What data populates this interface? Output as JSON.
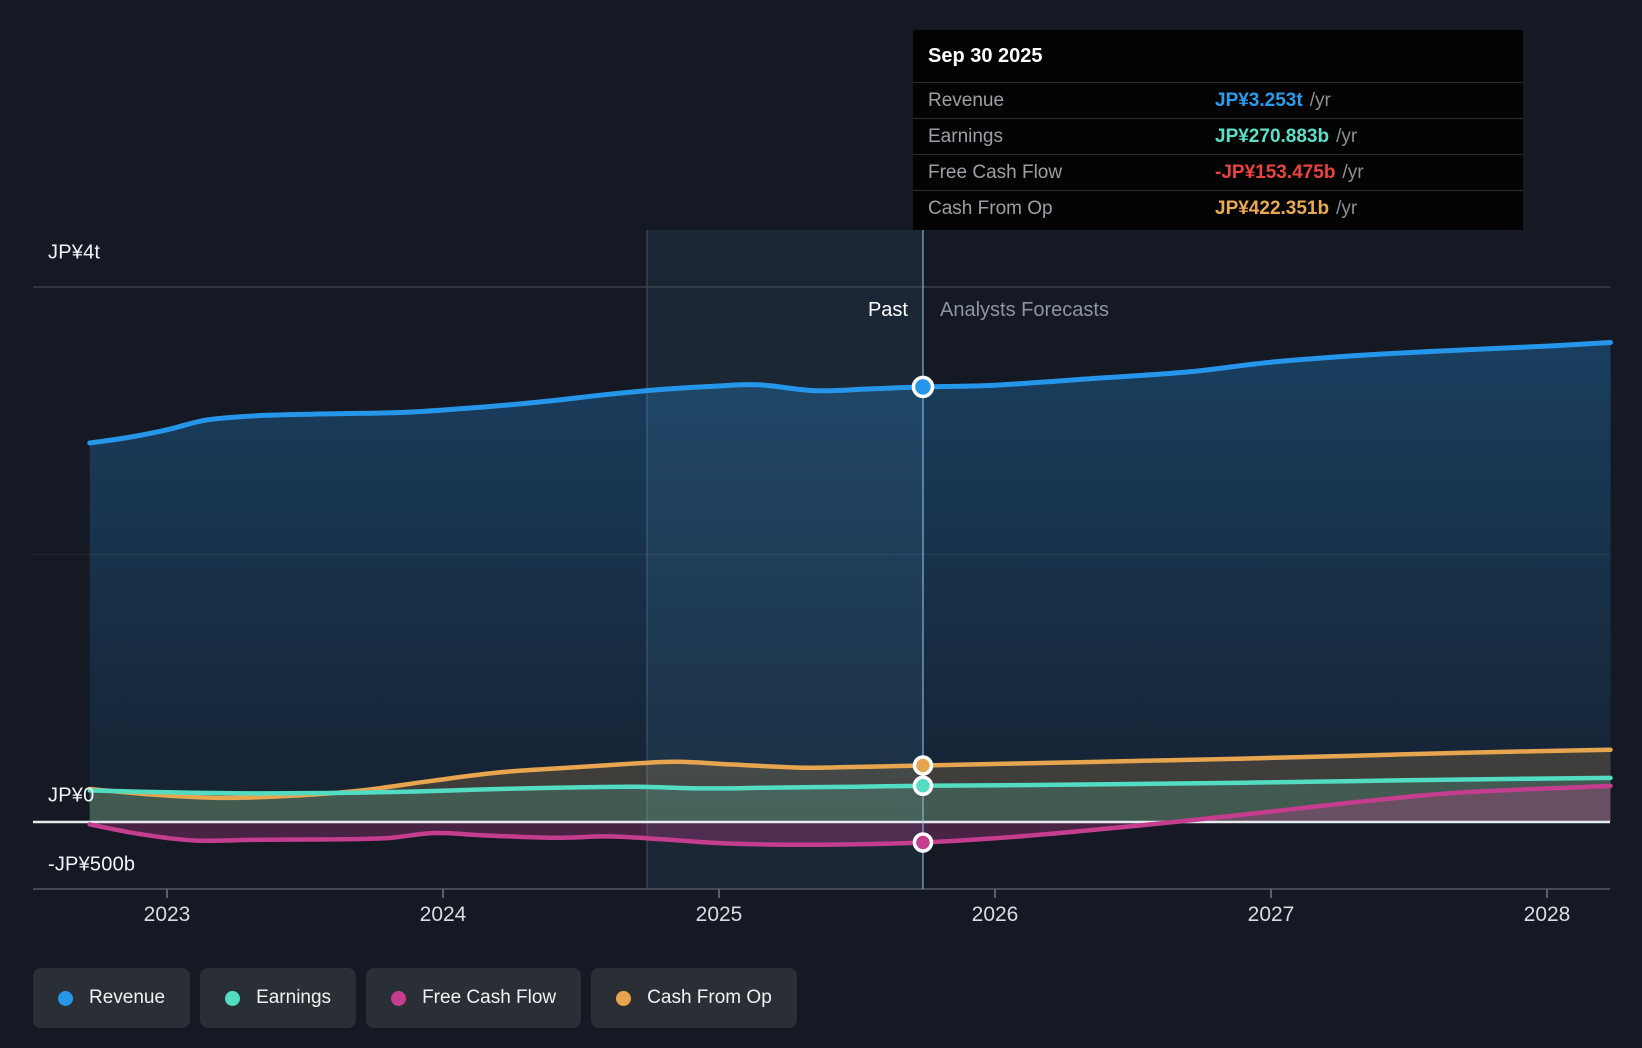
{
  "tooltip": {
    "date": "Sep 30 2025",
    "rows": [
      {
        "label": "Revenue",
        "value": "JP¥3.253t",
        "suffix": "/yr",
        "color": "#2b9df0"
      },
      {
        "label": "Earnings",
        "value": "JP¥270.883b",
        "suffix": "/yr",
        "color": "#5be0c8"
      },
      {
        "label": "Free Cash Flow",
        "value": "-JP¥153.475b",
        "suffix": "/yr",
        "color": "#ea443e"
      },
      {
        "label": "Cash From Op",
        "value": "JP¥422.351b",
        "suffix": "/yr",
        "color": "#ebaa50"
      }
    ]
  },
  "sections": {
    "past": "Past",
    "forecast": "Analysts Forecasts"
  },
  "legend": [
    {
      "label": "Revenue",
      "color": "#2696ea"
    },
    {
      "label": "Earnings",
      "color": "#52dcc2"
    },
    {
      "label": "Free Cash Flow",
      "color": "#c53d8e"
    },
    {
      "label": "Cash From Op",
      "color": "#e7a54f"
    }
  ],
  "chart_data": {
    "type": "area",
    "title": "",
    "unit": "JP¥ billions",
    "x_axis": {
      "ticks": [
        2023,
        2024,
        2025,
        2026,
        2027,
        2028
      ],
      "labels": [
        "2023",
        "2024",
        "2025",
        "2026",
        "2027",
        "2028"
      ]
    },
    "y_axis": {
      "labels": [
        {
          "text": "JP¥4t",
          "value_b": 4000
        },
        {
          "text": "JP¥0",
          "value_b": 0
        },
        {
          "text": "-JP¥500b",
          "value_b": -500
        }
      ],
      "gridlines_b": [
        4000,
        2000,
        0,
        -500
      ]
    },
    "x_domain": [
      2022.721,
      2028.228
    ],
    "divider": {
      "year": 2025.739,
      "highlight_band_years": 1
    },
    "grid": true,
    "legend_position": "bottom",
    "series": [
      {
        "name": "Revenue",
        "color": "#2696ea",
        "marker_value_b": 3253,
        "points": [
          [
            2022.72,
            2834
          ],
          [
            2022.85,
            2872
          ],
          [
            2023.0,
            2932
          ],
          [
            2023.15,
            3008
          ],
          [
            2023.35,
            3040
          ],
          [
            2023.6,
            3052
          ],
          [
            2023.85,
            3062
          ],
          [
            2024.1,
            3095
          ],
          [
            2024.35,
            3140
          ],
          [
            2024.6,
            3198
          ],
          [
            2024.8,
            3235
          ],
          [
            2025.0,
            3260
          ],
          [
            2025.15,
            3268
          ],
          [
            2025.35,
            3225
          ],
          [
            2025.55,
            3238
          ],
          [
            2025.739,
            3253
          ],
          [
            2026.0,
            3266
          ],
          [
            2026.35,
            3315
          ],
          [
            2026.7,
            3365
          ],
          [
            2027.0,
            3438
          ],
          [
            2027.35,
            3492
          ],
          [
            2027.7,
            3530
          ],
          [
            2028.0,
            3558
          ],
          [
            2028.23,
            3585
          ]
        ]
      },
      {
        "name": "Cash From Op",
        "color": "#e7a54f",
        "marker_value_b": 422.351,
        "points": [
          [
            2022.72,
            247
          ],
          [
            2022.95,
            205
          ],
          [
            2023.2,
            180
          ],
          [
            2023.45,
            196
          ],
          [
            2023.7,
            235
          ],
          [
            2023.95,
            305
          ],
          [
            2024.2,
            370
          ],
          [
            2024.45,
            405
          ],
          [
            2024.7,
            438
          ],
          [
            2024.85,
            450
          ],
          [
            2025.05,
            430
          ],
          [
            2025.3,
            406
          ],
          [
            2025.5,
            412
          ],
          [
            2025.739,
            422.351
          ],
          [
            2026.1,
            438
          ],
          [
            2026.5,
            456
          ],
          [
            2026.9,
            474
          ],
          [
            2027.3,
            495
          ],
          [
            2027.7,
            518
          ],
          [
            2028.23,
            540
          ]
        ]
      },
      {
        "name": "Earnings",
        "color": "#52dcc2",
        "marker_value_b": 270.883,
        "points": [
          [
            2022.72,
            236
          ],
          [
            2023.0,
            222
          ],
          [
            2023.3,
            214
          ],
          [
            2023.6,
            217
          ],
          [
            2023.9,
            228
          ],
          [
            2024.15,
            244
          ],
          [
            2024.45,
            258
          ],
          [
            2024.7,
            263
          ],
          [
            2024.95,
            251
          ],
          [
            2025.2,
            257
          ],
          [
            2025.5,
            264
          ],
          [
            2025.739,
            270.883
          ],
          [
            2026.1,
            276
          ],
          [
            2026.5,
            284
          ],
          [
            2026.9,
            294
          ],
          [
            2027.3,
            306
          ],
          [
            2027.7,
            318
          ],
          [
            2028.23,
            330
          ]
        ]
      },
      {
        "name": "Free Cash Flow",
        "color": "#c53d8e",
        "marker_value_b": -153.475,
        "points": [
          [
            2022.72,
            -18
          ],
          [
            2022.9,
            -90
          ],
          [
            2023.1,
            -138
          ],
          [
            2023.35,
            -132
          ],
          [
            2023.6,
            -130
          ],
          [
            2023.8,
            -120
          ],
          [
            2023.97,
            -82
          ],
          [
            2024.15,
            -100
          ],
          [
            2024.4,
            -118
          ],
          [
            2024.6,
            -108
          ],
          [
            2024.8,
            -130
          ],
          [
            2025.0,
            -158
          ],
          [
            2025.25,
            -170
          ],
          [
            2025.5,
            -167
          ],
          [
            2025.739,
            -153.475
          ],
          [
            2026.0,
            -122
          ],
          [
            2026.3,
            -70
          ],
          [
            2026.65,
            0
          ],
          [
            2027.0,
            78
          ],
          [
            2027.35,
            158
          ],
          [
            2027.7,
            222
          ],
          [
            2028.23,
            270
          ]
        ]
      }
    ]
  }
}
